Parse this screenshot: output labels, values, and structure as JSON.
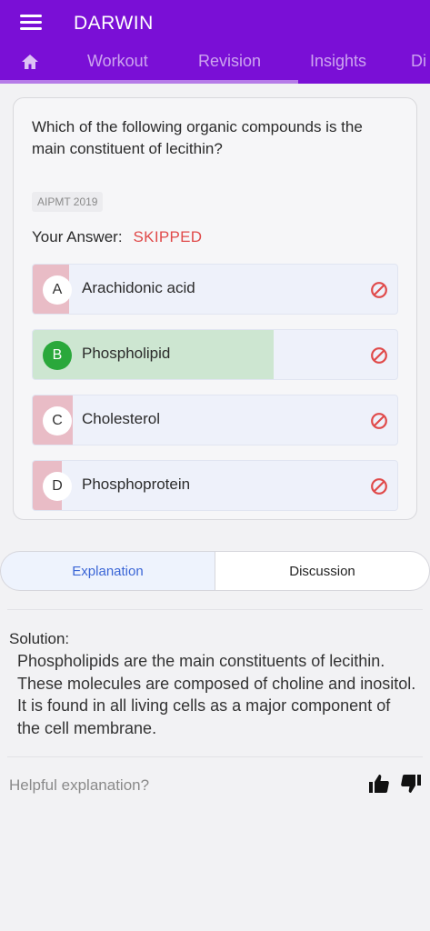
{
  "header": {
    "title": "DARWIN",
    "tabs": [
      {
        "label": "Workout"
      },
      {
        "label": "Revision"
      },
      {
        "label": "Insights"
      },
      {
        "label": "Di"
      }
    ]
  },
  "question": {
    "text": "Which of the following organic compounds is the main constituent of lecithin?",
    "tag": "AIPMT 2019",
    "answer_label": "Your Answer:",
    "answer_status": "SKIPPED",
    "options": [
      {
        "letter": "A",
        "text": "Arachidonic acid",
        "percent": 10,
        "correct": false
      },
      {
        "letter": "B",
        "text": "Phospholipid",
        "percent": 66,
        "correct": true
      },
      {
        "letter": "C",
        "text": "Cholesterol",
        "percent": 11,
        "correct": false
      },
      {
        "letter": "D",
        "text": "Phosphoprotein",
        "percent": 8,
        "correct": false
      }
    ]
  },
  "segments": {
    "explanation": "Explanation",
    "discussion": "Discussion",
    "active": "Explanation"
  },
  "solution": {
    "title": "Solution:",
    "text": "Phospholipids are the main constituents of lecithin. These molecules are composed of choline and inositol. It is found in all living cells as a major component of the cell membrane."
  },
  "feedback": {
    "prompt": "Helpful explanation?"
  },
  "colors": {
    "header": "#7a0fd6",
    "correct_fill": "#cde6d1",
    "wrong_fill": "#e9bcc6",
    "skipped": "#e04a4a",
    "accent": "#3b66d6"
  }
}
